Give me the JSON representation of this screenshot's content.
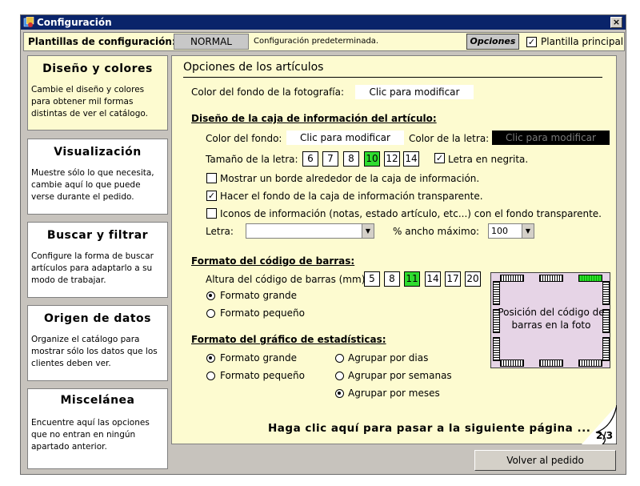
{
  "window": {
    "title": "Configuración",
    "close": "×"
  },
  "toolbar": {
    "label": "Plantillas de configuración:",
    "preset": "NORMAL",
    "preset_desc": "Configuración predeterminada.",
    "options_button": "Opciones",
    "main_template_label": "Plantilla principal",
    "main_template_checked": true
  },
  "sidebar": [
    {
      "title": "Diseño y colores",
      "desc": "Cambie el diseño y colores para obtener mil formas distintas de ver el catálogo."
    },
    {
      "title": "Visualización",
      "desc": "Muestre sólo lo que necesita, cambie aquí lo que puede verse durante el pedido."
    },
    {
      "title": "Buscar y filtrar",
      "desc": "Configure la forma de buscar artículos para adaptarlo a su modo de trabajar."
    },
    {
      "title": "Origen de datos",
      "desc": "Organize el catálogo para mostrar sólo los datos que los clientes deben ver."
    },
    {
      "title": "Miscelánea",
      "desc": "Encuentre aquí las opciones que no entran en ningún apartado anterior."
    }
  ],
  "main": {
    "title": "Opciones de los artículos",
    "photo_bg_label": "Color del fondo de la fotografía:",
    "click_modify": "Clic para modificar",
    "info_box": {
      "heading": "Diseño de la caja de información del artículo:",
      "bg_label": "Color del fondo:",
      "font_color_label": "Color de la letra:",
      "size_label": "Tamaño de la letra:",
      "sizes": [
        "6",
        "7",
        "8",
        "10",
        "12",
        "14"
      ],
      "selected_size": "10",
      "bold_label": "Letra en negrita.",
      "bold_checked": true,
      "border_label": "Mostrar un borde alrededor de la caja de información.",
      "border_checked": false,
      "transparent_label": "Hacer el fondo de la caja de información transparente.",
      "transparent_checked": true,
      "icons_label": "Iconos de información (notas, estado artículo, etc...) con el fondo transparente.",
      "icons_checked": false,
      "font_label": "Letra:",
      "font_value": "",
      "width_label": "% ancho máximo:",
      "width_value": "100"
    },
    "barcode": {
      "heading": "Formato del código de barras:",
      "height_label": "Altura del código de barras (mm):",
      "heights": [
        "5",
        "8",
        "11",
        "14",
        "17",
        "20"
      ],
      "selected_height": "11",
      "large_label": "Formato grande",
      "small_label": "Formato pequeño",
      "selected_format": "large",
      "position_text": "Posición del código de barras en la foto"
    },
    "stats": {
      "heading": "Formato del gráfico de estadísticas:",
      "large_label": "Formato grande",
      "small_label": "Formato pequeño",
      "selected_format": "large",
      "group_days": "Agrupar por dias",
      "group_weeks": "Agrupar por semanas",
      "group_months": "Agrupar por meses",
      "selected_group": "months"
    },
    "next_link": "Haga clic aquí para pasar a la siguiente página ...",
    "page": "2/3"
  },
  "footer": {
    "back_button": "Volver al pedido"
  },
  "colors": {
    "title_bar": "#0a246a",
    "panel_bg": "#fdfbd0",
    "selected_green": "#2fdc2f",
    "window_bg": "#c7c3bd"
  }
}
